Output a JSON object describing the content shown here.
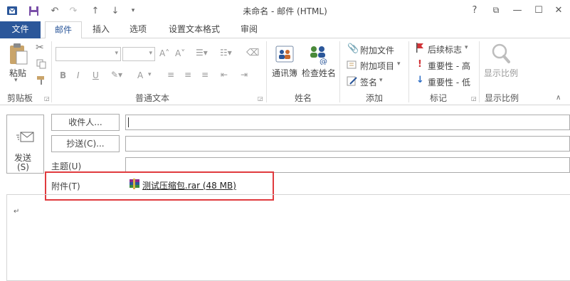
{
  "window": {
    "title": "未命名 - 邮件 (HTML)",
    "help": "?",
    "restore_ribbon": "⧉",
    "minimize": "—",
    "maximize": "☐",
    "close": "✕"
  },
  "tabs": [
    {
      "label": "文件"
    },
    {
      "label": "邮件"
    },
    {
      "label": "插入"
    },
    {
      "label": "选项"
    },
    {
      "label": "设置文本格式"
    },
    {
      "label": "审阅"
    }
  ],
  "ribbon": {
    "clipboard": {
      "paste": "粘贴",
      "group": "剪贴板"
    },
    "basic_text": {
      "group": "普通文本",
      "bold": "B",
      "italic": "I",
      "underline": "U",
      "grow": "A˄",
      "shrink": "A˅",
      "font_color": "A"
    },
    "names": {
      "address_book": "通讯簿",
      "check_names": "检查姓名",
      "group": "姓名"
    },
    "include": {
      "attach_file": "附加文件",
      "attach_item": "附加项目",
      "signature": "签名",
      "group": "添加"
    },
    "tags": {
      "follow_up": "后续标志",
      "high": "重要性 - 高",
      "low": "重要性 - 低",
      "group": "标记"
    },
    "zoom": {
      "zoom": "显示比例",
      "group": "显示比例"
    }
  },
  "compose": {
    "send": "发送",
    "send_key": "(S)",
    "to_button": "收件人...",
    "cc_button": "抄送(C)...",
    "subject_label": "主题(U)",
    "attachment_label": "附件(T)",
    "attachment_name": "测试压缩包.rar (48 MB)",
    "paragraph_mark": "↵"
  },
  "colors": {
    "accent": "#2b579a",
    "highlight_box": "#e03a3e",
    "flag_red": "#d13438",
    "low_arrow": "#2b6cc4"
  }
}
